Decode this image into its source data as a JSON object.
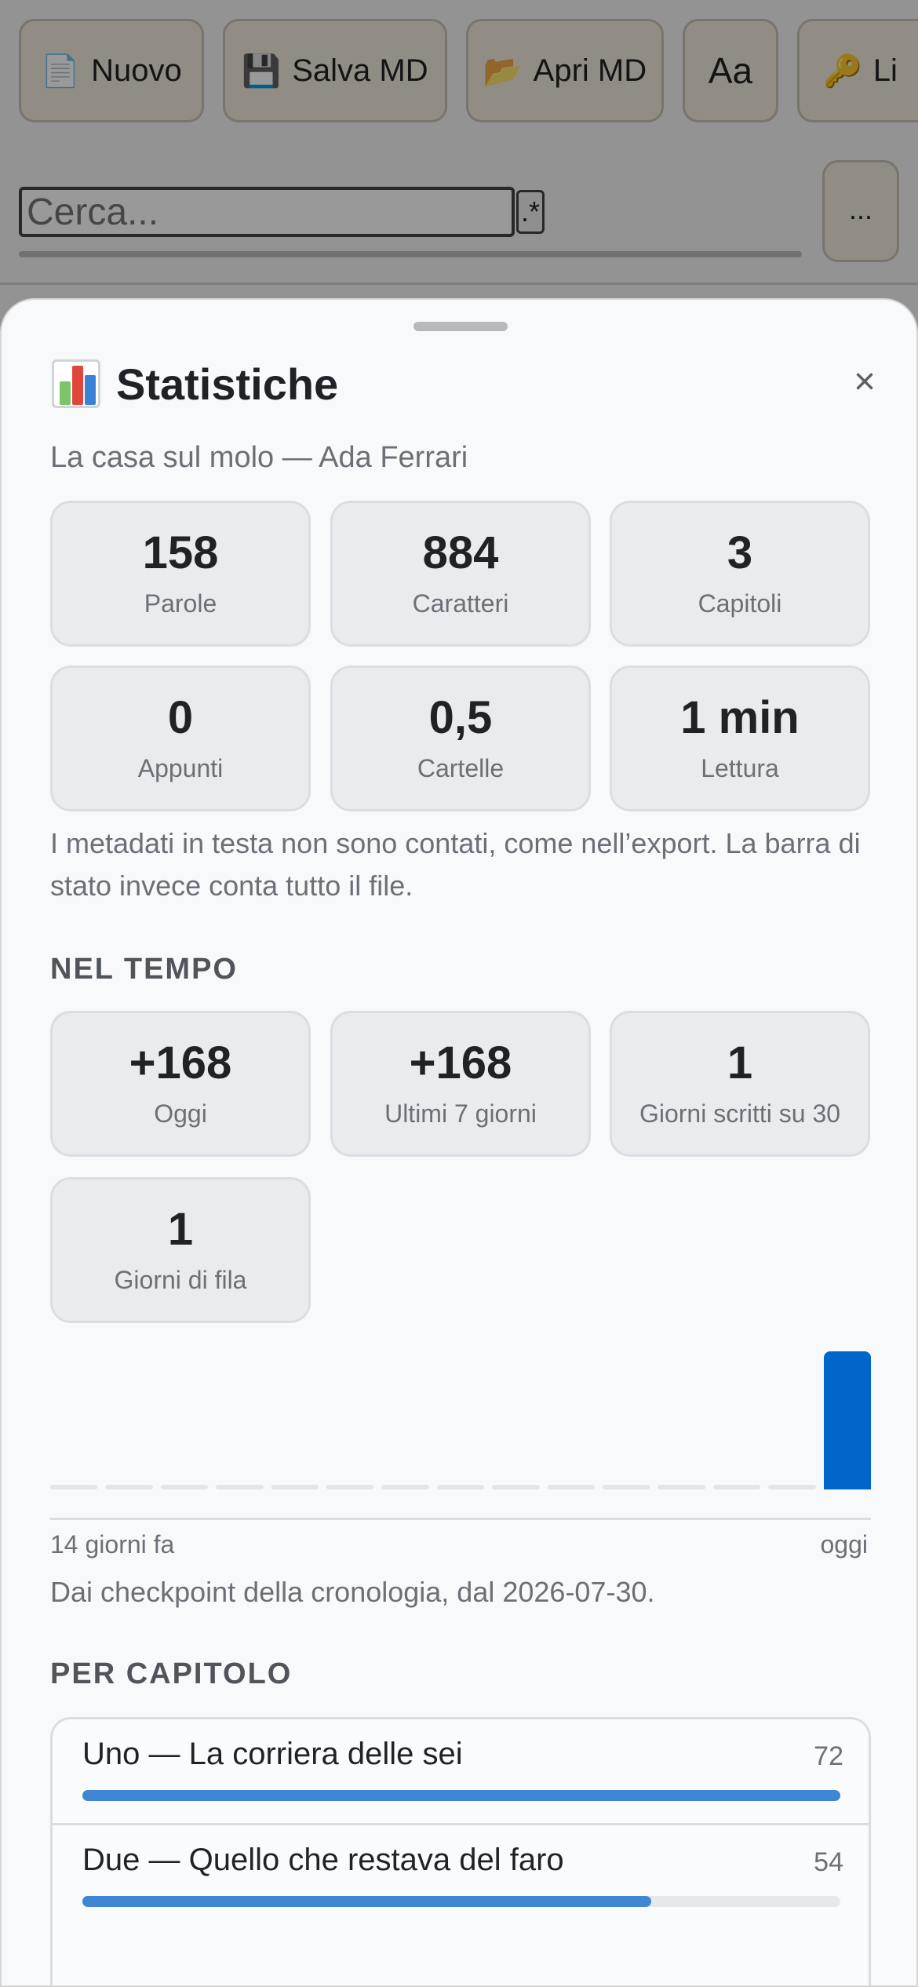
{
  "toolbar": {
    "buttons": [
      {
        "icon": "📄",
        "label": "Nuovo"
      },
      {
        "icon": "💾",
        "label": "Salva MD"
      },
      {
        "icon": "📂",
        "label": "Apri MD"
      },
      {
        "icon": "",
        "label": "Aa"
      },
      {
        "icon": "🔑",
        "label": "Li"
      }
    ]
  },
  "search": {
    "placeholder": "Cerca...",
    "regex_label": ".*",
    "more_label": "..."
  },
  "sheet": {
    "title": "Statistiche",
    "close_label": "×",
    "subtitle": "La casa sul molo — Ada Ferrari",
    "stats": [
      {
        "value": "158",
        "label": "Parole"
      },
      {
        "value": "884",
        "label": "Caratteri"
      },
      {
        "value": "3",
        "label": "Capitoli"
      },
      {
        "value": "0",
        "label": "Appunti"
      },
      {
        "value": "0,5",
        "label": "Cartelle"
      },
      {
        "value": "1 min",
        "label": "Lettura"
      }
    ],
    "note": "I metadati in testa non sono contati, come nell’export. La barra di stato invece conta tutto il file.",
    "time_section": {
      "heading": "NEL TEMPO",
      "stats": [
        {
          "value": "+168",
          "label": "Oggi"
        },
        {
          "value": "+168",
          "label": "Ultimi 7 giorni"
        },
        {
          "value": "1",
          "label": "Giorni scritti su 30"
        },
        {
          "value": "1",
          "label": "Giorni di fila"
        }
      ],
      "axis_start": "14 giorni fa",
      "axis_end": "oggi",
      "chart_note": "Dai checkpoint della cronologia, dal 2026-07-30."
    },
    "chapter_section": {
      "heading": "PER CAPITOLO",
      "chapters": [
        {
          "title": "Uno — La corriera delle sei",
          "words": "72",
          "fraction": 1.0
        },
        {
          "title": "Due — Quello che restava del faro",
          "words": "54",
          "fraction": 0.75
        }
      ]
    }
  },
  "colors": {
    "accent": "#0066cc",
    "chapter_bar": "#3f86d4"
  },
  "chart_data": {
    "type": "bar",
    "categories": [
      "-14",
      "-13",
      "-12",
      "-11",
      "-10",
      "-9",
      "-8",
      "-7",
      "-6",
      "-5",
      "-4",
      "-3",
      "-2",
      "-1",
      "0"
    ],
    "values": [
      0,
      0,
      0,
      0,
      0,
      0,
      0,
      0,
      0,
      0,
      0,
      0,
      0,
      0,
      168
    ],
    "xlabel": "",
    "ylabel": ""
  }
}
